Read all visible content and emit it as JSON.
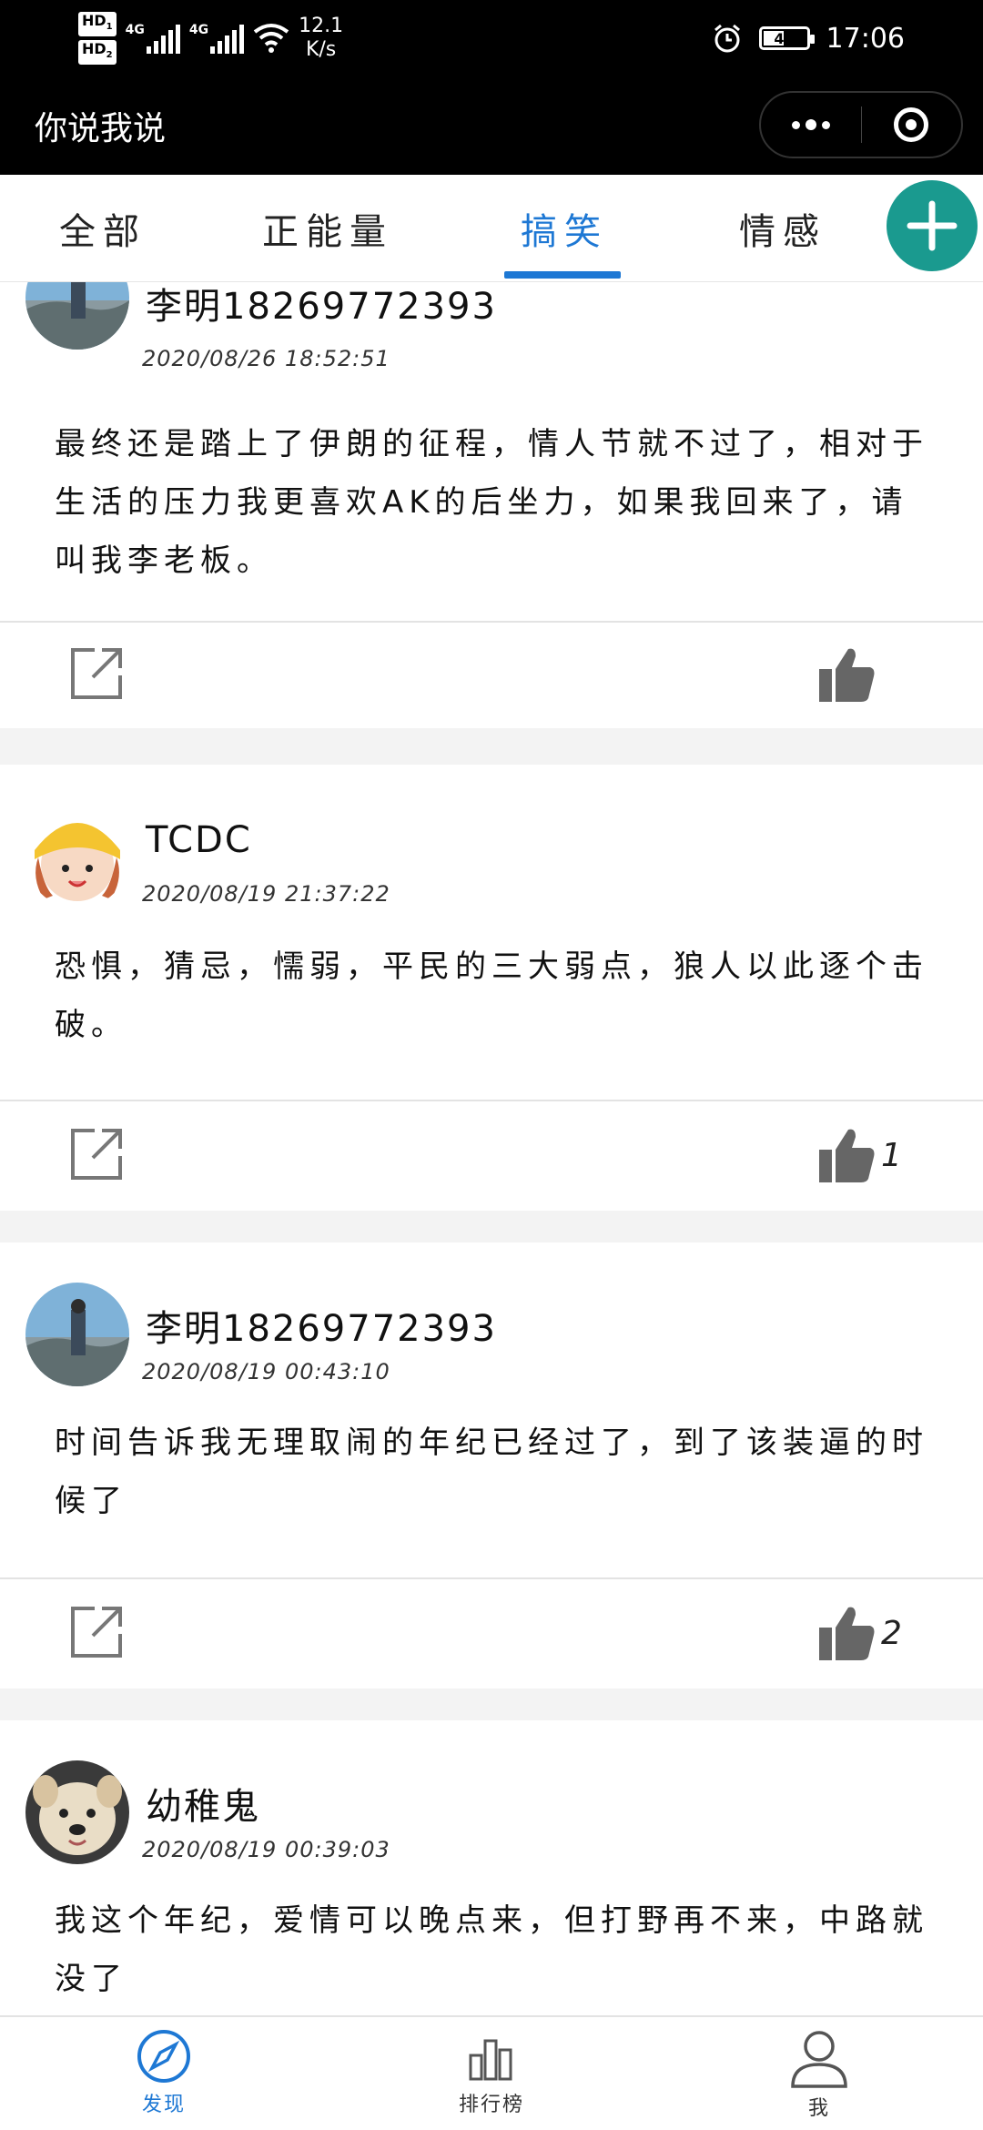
{
  "status_bar": {
    "hd1": "HD",
    "hd1_sub": "1",
    "hd2": "HD",
    "hd2_sub": "2",
    "net1": "4G",
    "net2": "4G",
    "speed_value": "12.1",
    "speed_unit": "K/s",
    "battery": "43",
    "time": "17:06"
  },
  "header": {
    "title": "你说我说"
  },
  "tabs": [
    {
      "label": "全部",
      "active": false
    },
    {
      "label": "正能量",
      "active": false
    },
    {
      "label": "搞笑",
      "active": true
    },
    {
      "label": "情感",
      "active": false
    }
  ],
  "posts": [
    {
      "username": "李明18269772393",
      "time": "2020/08/26 18:52:51",
      "content": "最终还是踏上了伊朗的征程，情人节就不过了，相对于生活的压力我更喜欢AK的后坐力，如果我回来了，请叫我李老板。",
      "likes": ""
    },
    {
      "username": "TCDC",
      "time": "2020/08/19 21:37:22",
      "content": "恐惧，猜忌，懦弱，平民的三大弱点，狼人以此逐个击破。",
      "likes": "1"
    },
    {
      "username": "李明18269772393",
      "time": "2020/08/19 00:43:10",
      "content": "时间告诉我无理取闹的年纪已经过了，到了该装逼的时候了",
      "likes": "2"
    },
    {
      "username": "幼稚鬼",
      "time": "2020/08/19 00:39:03",
      "content": "我这个年纪，爱情可以晚点来，但打野再不来，中路就没了",
      "likes": ""
    }
  ],
  "bottom_nav": [
    {
      "label": "发现",
      "icon": "compass-icon",
      "active": true
    },
    {
      "label": "排行榜",
      "icon": "bar-chart-icon",
      "active": false
    },
    {
      "label": "我",
      "icon": "person-icon",
      "active": false
    }
  ],
  "colors": {
    "accent": "#1e78d4",
    "add_button": "#1a9a8f",
    "icon_gray": "#666666"
  }
}
